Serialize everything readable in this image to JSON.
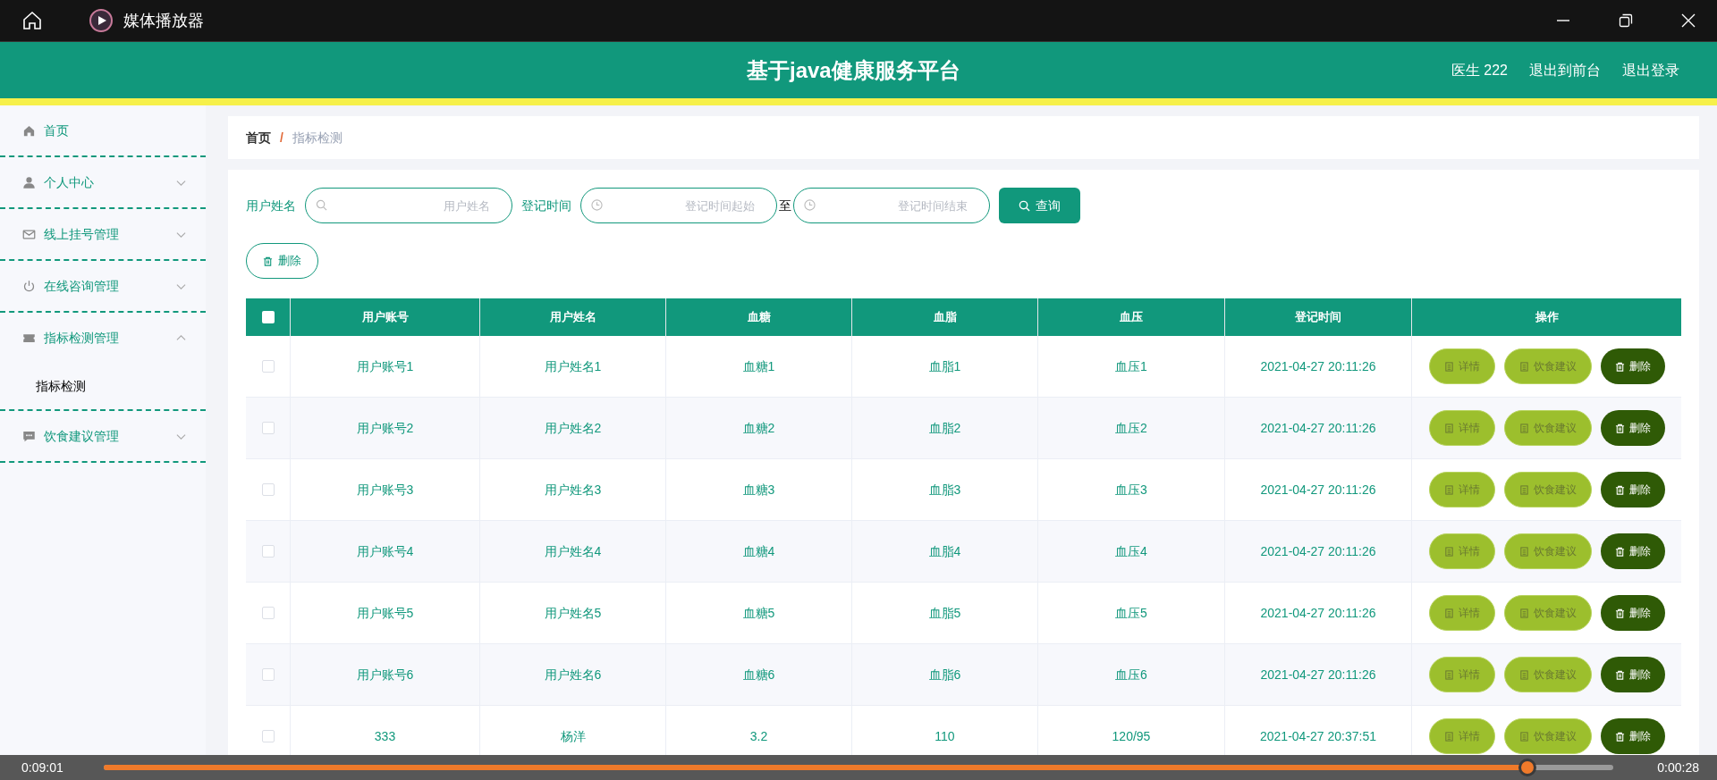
{
  "player": {
    "title": "媒体播放器",
    "elapsed": "0:09:01",
    "remaining": "0:00:28",
    "level": 0.943
  },
  "header": {
    "title": "基于java健康服务平台",
    "links": [
      "医生 222",
      "退出到前台",
      "退出登录"
    ]
  },
  "sidebar": {
    "items": [
      {
        "label": "首页",
        "kind": "link"
      },
      {
        "label": "个人中心",
        "kind": "menu",
        "expanded": false
      },
      {
        "label": "线上挂号管理",
        "kind": "menu",
        "expanded": false
      },
      {
        "label": "在线咨询管理",
        "kind": "menu",
        "expanded": false
      },
      {
        "label": "指标检测管理",
        "kind": "menu",
        "expanded": true,
        "children": [
          {
            "label": "指标检测",
            "selected": true
          }
        ]
      },
      {
        "label": "饮食建议管理",
        "kind": "menu",
        "expanded": false
      }
    ]
  },
  "breadcrumb": {
    "items": [
      "首页",
      "指标检测"
    ],
    "separator": "/"
  },
  "filters": {
    "name_label": "用户姓名",
    "name_placeholder": "用户姓名",
    "time_label": "登记时间",
    "start_placeholder": "登记时间起始",
    "separator": "至",
    "end_placeholder": "登记时间结束",
    "search_button": "查询"
  },
  "delete_button": "删除",
  "table": {
    "select_all": {
      "checked": false
    },
    "columns": [
      "用户账号",
      "用户姓名",
      "血糖",
      "血脂",
      "血压",
      "登记时间",
      "操作"
    ],
    "rows": [
      {
        "checked": false,
        "cells": [
          "用户账号1",
          "用户姓名1",
          "血糖1",
          "血脂1",
          "血压1",
          "2021-04-27 20:11:26"
        ],
        "actions": [
          "详情",
          "饮食建议",
          "删除"
        ]
      },
      {
        "checked": false,
        "cells": [
          "用户账号2",
          "用户姓名2",
          "血糖2",
          "血脂2",
          "血压2",
          "2021-04-27 20:11:26"
        ],
        "actions": [
          "详情",
          "饮食建议",
          "删除"
        ]
      },
      {
        "checked": false,
        "cells": [
          "用户账号3",
          "用户姓名3",
          "血糖3",
          "血脂3",
          "血压3",
          "2021-04-27 20:11:26"
        ],
        "actions": [
          "详情",
          "饮食建议",
          "删除"
        ]
      },
      {
        "checked": false,
        "cells": [
          "用户账号4",
          "用户姓名4",
          "血糖4",
          "血脂4",
          "血压4",
          "2021-04-27 20:11:26"
        ],
        "actions": [
          "详情",
          "饮食建议",
          "删除"
        ]
      },
      {
        "checked": false,
        "cells": [
          "用户账号5",
          "用户姓名5",
          "血糖5",
          "血脂5",
          "血压5",
          "2021-04-27 20:11:26"
        ],
        "actions": [
          "详情",
          "饮食建议",
          "删除"
        ]
      },
      {
        "checked": false,
        "cells": [
          "用户账号6",
          "用户姓名6",
          "血糖6",
          "血脂6",
          "血压6",
          "2021-04-27 20:11:26"
        ],
        "actions": [
          "详情",
          "饮食建议",
          "删除"
        ]
      },
      {
        "checked": false,
        "cells": [
          "333",
          "杨洋",
          "3.2",
          "110",
          "120/95",
          "2021-04-27 20:37:51"
        ],
        "actions": [
          "详情",
          "饮食建议",
          "删除"
        ]
      }
    ]
  }
}
